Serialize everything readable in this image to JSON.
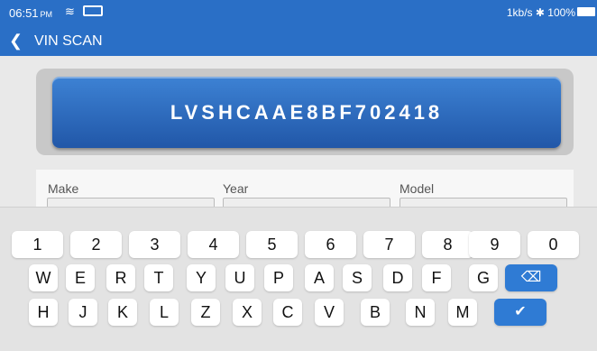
{
  "status": {
    "time": "06:51",
    "ampm": "PM",
    "wifi_icon": "wifi-icon",
    "net_speed": "1kb/s",
    "bluetooth_icon": "bluetooth-icon",
    "battery": "100%"
  },
  "nav": {
    "back_icon": "chevron-left-icon",
    "title": "VIN SCAN"
  },
  "vin": {
    "value": "LVSHCAAE8BF702418"
  },
  "fields": {
    "make_label": "Make",
    "year_label": "Year",
    "model_label": "Model"
  },
  "keyboard": {
    "row1": [
      "1",
      "2",
      "3",
      "4",
      "5",
      "6",
      "7",
      "8",
      "9",
      "0"
    ],
    "row2": [
      "W",
      "E",
      "R",
      "T",
      "Y",
      "U",
      "P",
      "A",
      "S",
      "D",
      "F",
      "G"
    ],
    "row3": [
      "H",
      "J",
      "K",
      "L",
      "Z",
      "X",
      "C",
      "V",
      "B",
      "N",
      "M"
    ],
    "backspace_icon": "backspace-icon",
    "confirm_icon": "check-icon"
  },
  "colors": {
    "header": "#2a6fc6",
    "vin_button": "#2a67bd",
    "key_action": "#2f7bd4"
  }
}
